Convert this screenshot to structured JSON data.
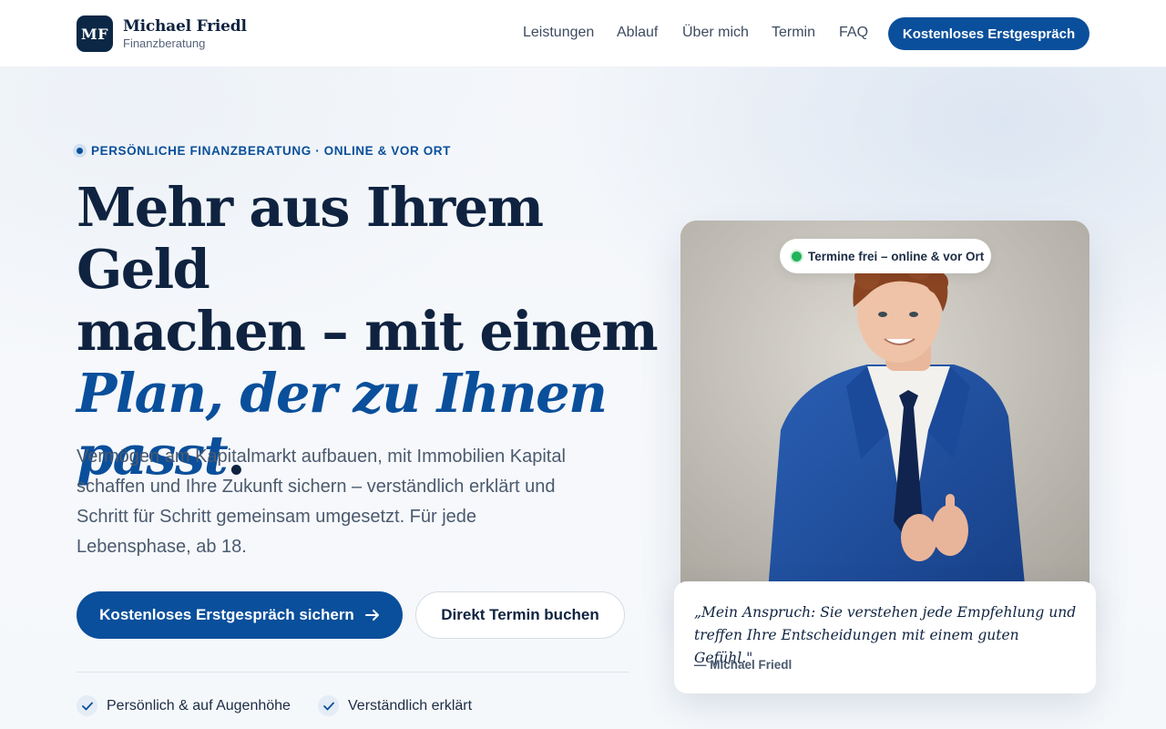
{
  "brand": {
    "mark": "MF",
    "name": "Michael Friedl",
    "subtitle": "Finanzberatung"
  },
  "nav": {
    "items": [
      "Leistungen",
      "Ablauf",
      "Über mich",
      "Termin",
      "FAQ"
    ],
    "cta": "Kostenloses Erstgespräch"
  },
  "hero": {
    "eyebrow": "PERSÖNLICHE FINANZBERATUNG · ONLINE & VOR ORT",
    "headline_line1": "Mehr aus Ihrem Geld",
    "headline_line2": "machen – mit einem",
    "headline_accent_line1": "Plan, der zu Ihnen",
    "headline_accent_line2": "passt",
    "headline_period": ".",
    "lead": "Vermögen am Kapitalmarkt aufbauen, mit Immobilien Kapital schaffen und Ihre Zukunft sichern – verständlich erklärt und Schritt für Schritt gemeinsam umgesetzt. Für jede Lebensphase, ab 18.",
    "primary_cta": "Kostenloses Erstgespräch sichern",
    "secondary_cta": "Direkt Termin buchen",
    "features": [
      "Persönlich & auf Augenhöhe",
      "Verständlich erklärt"
    ]
  },
  "profile": {
    "status": "Termine frei – online & vor Ort",
    "quote": "„Mein Anspruch: Sie verstehen jede Empfehlung und treffen Ihre Entscheidungen mit einem guten Gefühl.\"",
    "author": "— Michael Friedl"
  },
  "colors": {
    "primary": "#0a4f9b",
    "navy": "#0f2340",
    "status_green": "#22b45a"
  }
}
